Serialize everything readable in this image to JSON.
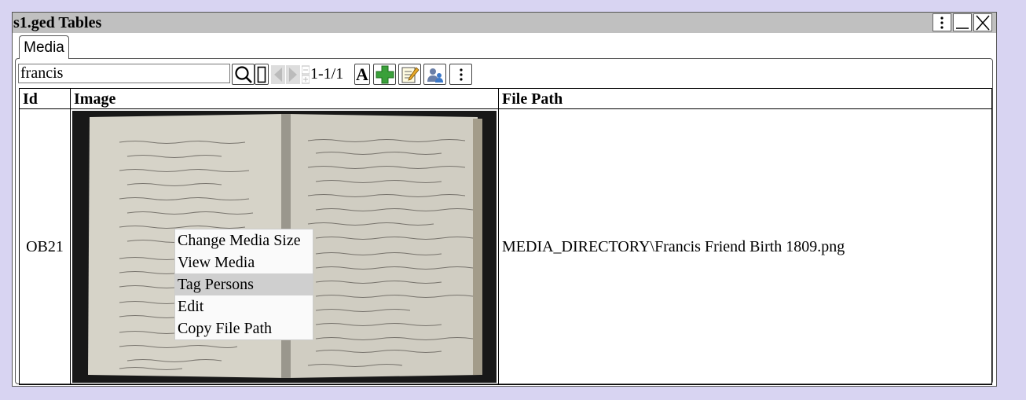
{
  "window": {
    "title": "s1.ged Tables"
  },
  "tabs": [
    {
      "label": "Media",
      "active": true
    }
  ],
  "toolbar": {
    "search_value": "francis",
    "record_count": "1-1/1",
    "font_button_label": "A",
    "icons": [
      "search-icon",
      "clear-search-icon",
      "prev-arrow-icon",
      "next-arrow-icon",
      "page-stepper-icon",
      "font-icon",
      "add-icon",
      "edit-icon",
      "tag-persons-icon",
      "more-menu-icon"
    ]
  },
  "table": {
    "columns": [
      "Id",
      "Image",
      "File Path"
    ],
    "rows": [
      {
        "id": "OB21",
        "image": "Francis Friend Birth 1809 register page",
        "file_path": "MEDIA_DIRECTORY\\Francis Friend Birth 1809.png"
      }
    ]
  },
  "context_menu": {
    "items": [
      {
        "label": "Change Media Size",
        "highlighted": false
      },
      {
        "label": "View Media",
        "highlighted": false
      },
      {
        "label": "Tag Persons",
        "highlighted": true
      },
      {
        "label": "Edit",
        "highlighted": false
      },
      {
        "label": "Copy File Path",
        "highlighted": false
      }
    ]
  },
  "colors": {
    "background": "#d8d4f2",
    "titlebar": "#c0c0c0",
    "menu_highlight": "#cfcfcf",
    "add_green": "#3aa03a"
  }
}
